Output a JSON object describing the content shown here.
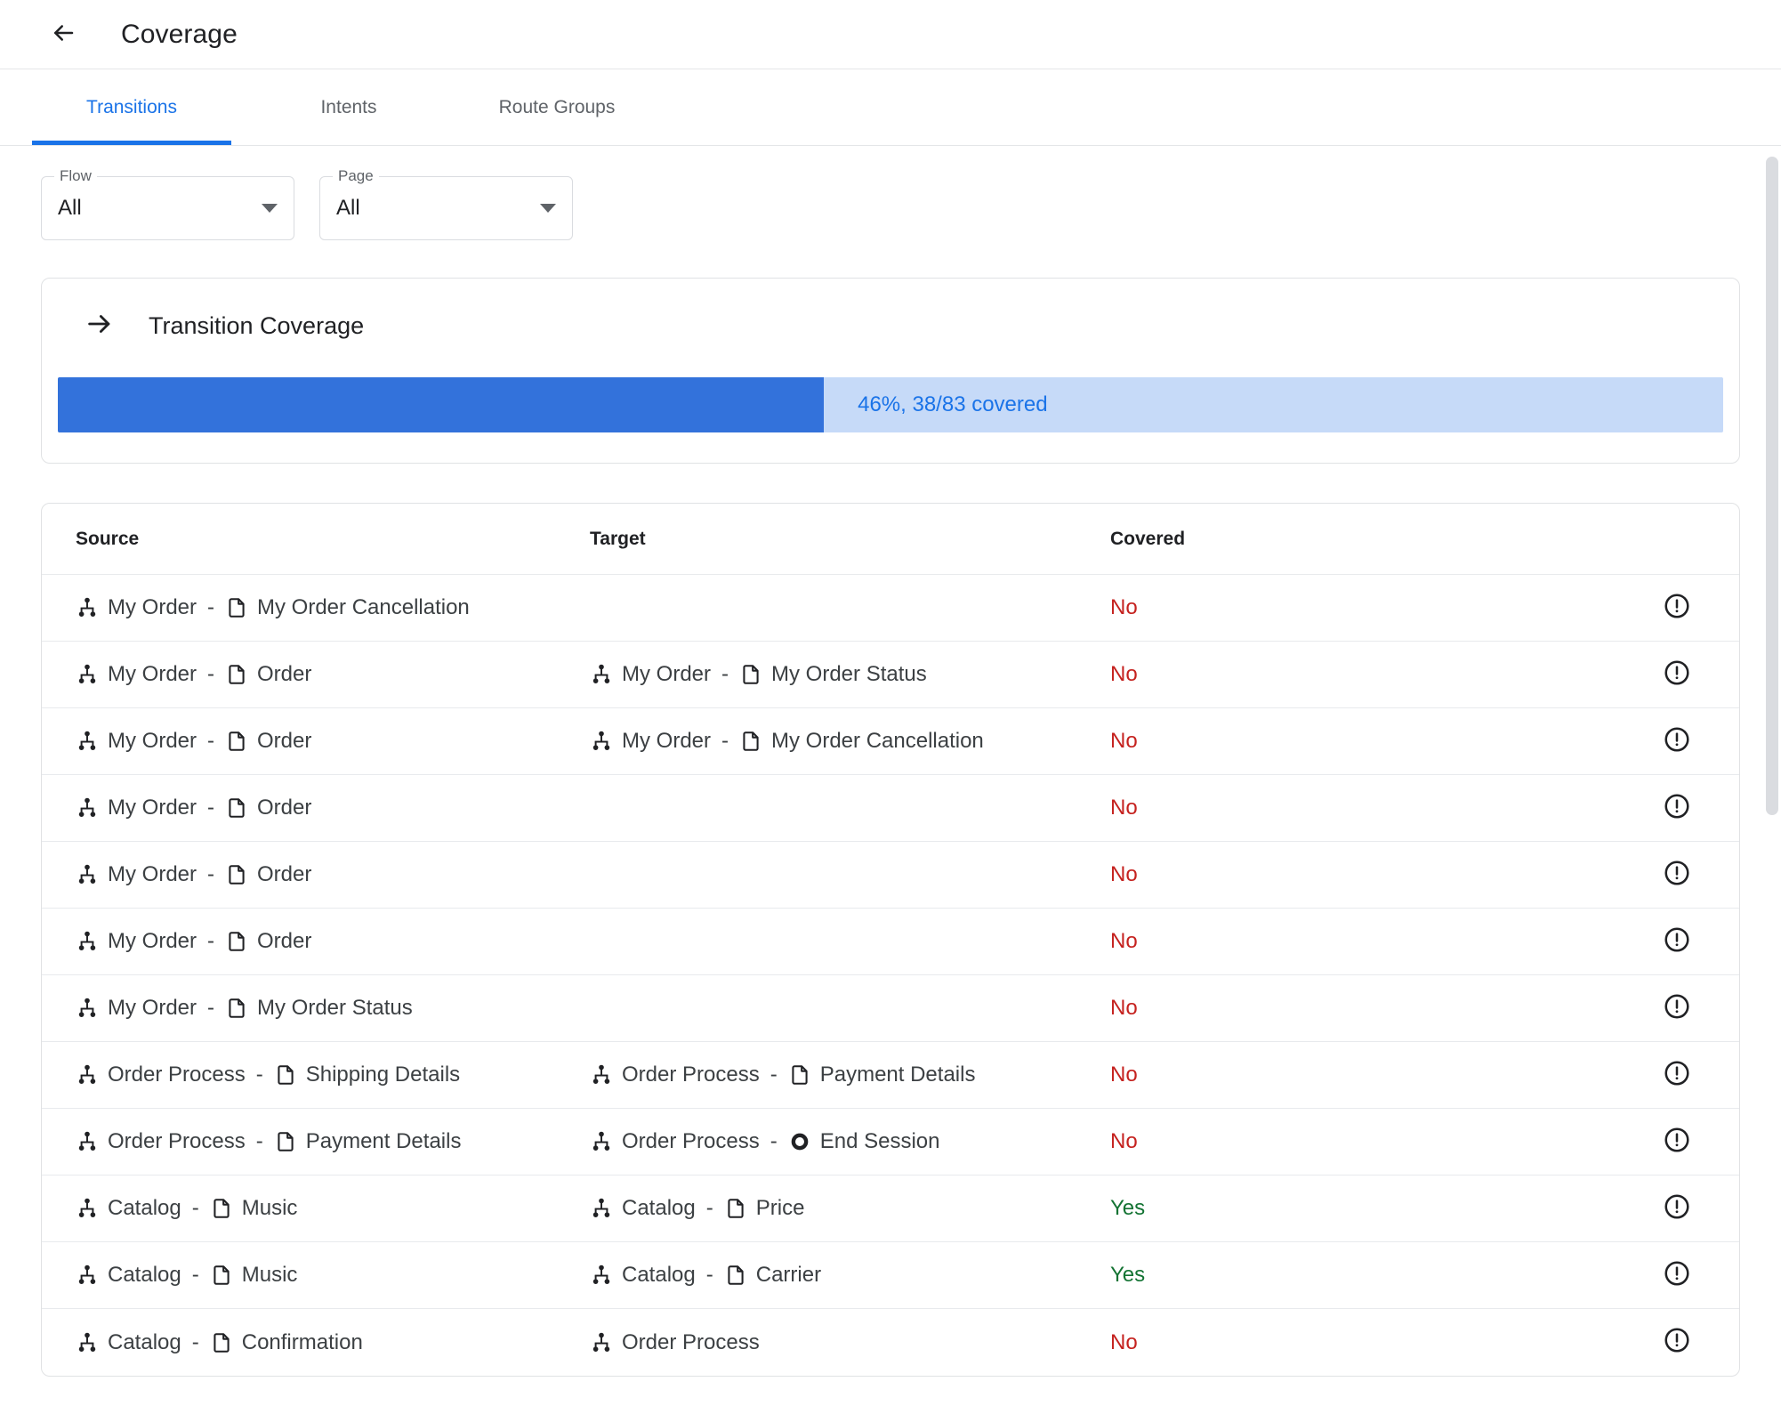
{
  "appbar": {
    "back_icon": "arrow-back-icon",
    "title": "Coverage"
  },
  "tabs": [
    {
      "label": "Transitions",
      "active": true
    },
    {
      "label": "Intents",
      "active": false
    },
    {
      "label": "Route Groups",
      "active": false
    }
  ],
  "filters": [
    {
      "label": "Flow",
      "value": "All",
      "icon": "chevron-down-icon"
    },
    {
      "label": "Page",
      "value": "All",
      "icon": "chevron-down-icon"
    }
  ],
  "coverage_card": {
    "icon": "arrow-forward-icon",
    "title": "Transition Coverage",
    "percent": 46,
    "covered": 38,
    "total": 83,
    "progress_text": "46%, 38/83 covered",
    "fill_color": "#3372db",
    "track_color": "#c6daf8",
    "text_color": "#1a73e8"
  },
  "table": {
    "columns": [
      "Source",
      "Target",
      "Covered"
    ],
    "row_icon": "error-outline-icon",
    "covered_yes_color": "#137333",
    "covered_no_color": "#c5221f",
    "rows": [
      {
        "source": {
          "flow_icon": "account-tree-icon",
          "flow": "My Order",
          "sep": "-",
          "node_icon": "page-icon",
          "node": "My Order Cancellation"
        },
        "target": null,
        "covered": "No"
      },
      {
        "source": {
          "flow_icon": "account-tree-icon",
          "flow": "My Order",
          "sep": "-",
          "node_icon": "page-icon",
          "node": "Order"
        },
        "target": {
          "flow_icon": "account-tree-icon",
          "flow": "My Order",
          "sep": "-",
          "node_icon": "page-icon",
          "node": "My Order Status"
        },
        "covered": "No"
      },
      {
        "source": {
          "flow_icon": "account-tree-icon",
          "flow": "My Order",
          "sep": "-",
          "node_icon": "page-icon",
          "node": "Order"
        },
        "target": {
          "flow_icon": "account-tree-icon",
          "flow": "My Order",
          "sep": "-",
          "node_icon": "page-icon",
          "node": "My Order Cancellation"
        },
        "covered": "No"
      },
      {
        "source": {
          "flow_icon": "account-tree-icon",
          "flow": "My Order",
          "sep": "-",
          "node_icon": "page-icon",
          "node": "Order"
        },
        "target": null,
        "covered": "No"
      },
      {
        "source": {
          "flow_icon": "account-tree-icon",
          "flow": "My Order",
          "sep": "-",
          "node_icon": "page-icon",
          "node": "Order"
        },
        "target": null,
        "covered": "No"
      },
      {
        "source": {
          "flow_icon": "account-tree-icon",
          "flow": "My Order",
          "sep": "-",
          "node_icon": "page-icon",
          "node": "Order"
        },
        "target": null,
        "covered": "No"
      },
      {
        "source": {
          "flow_icon": "account-tree-icon",
          "flow": "My Order",
          "sep": "-",
          "node_icon": "page-icon",
          "node": "My Order Status"
        },
        "target": null,
        "covered": "No"
      },
      {
        "source": {
          "flow_icon": "account-tree-icon",
          "flow": "Order Process",
          "sep": "-",
          "node_icon": "page-icon",
          "node": "Shipping Details"
        },
        "target": {
          "flow_icon": "account-tree-icon",
          "flow": "Order Process",
          "sep": "-",
          "node_icon": "page-icon",
          "node": "Payment Details"
        },
        "covered": "No"
      },
      {
        "source": {
          "flow_icon": "account-tree-icon",
          "flow": "Order Process",
          "sep": "-",
          "node_icon": "page-icon",
          "node": "Payment Details"
        },
        "target": {
          "flow_icon": "account-tree-icon",
          "flow": "Order Process",
          "sep": "-",
          "node_icon": "end-session-icon",
          "node": "End Session"
        },
        "covered": "No"
      },
      {
        "source": {
          "flow_icon": "account-tree-icon",
          "flow": "Catalog",
          "sep": "-",
          "node_icon": "page-icon",
          "node": "Music"
        },
        "target": {
          "flow_icon": "account-tree-icon",
          "flow": "Catalog",
          "sep": "-",
          "node_icon": "page-icon",
          "node": "Price"
        },
        "covered": "Yes"
      },
      {
        "source": {
          "flow_icon": "account-tree-icon",
          "flow": "Catalog",
          "sep": "-",
          "node_icon": "page-icon",
          "node": "Music"
        },
        "target": {
          "flow_icon": "account-tree-icon",
          "flow": "Catalog",
          "sep": "-",
          "node_icon": "page-icon",
          "node": "Carrier"
        },
        "covered": "Yes"
      },
      {
        "source": {
          "flow_icon": "account-tree-icon",
          "flow": "Catalog",
          "sep": "-",
          "node_icon": "page-icon",
          "node": "Confirmation"
        },
        "target": {
          "flow_icon": "account-tree-icon",
          "flow": "Order Process",
          "sep": "",
          "node_icon": "",
          "node": ""
        },
        "covered": "No"
      }
    ]
  }
}
